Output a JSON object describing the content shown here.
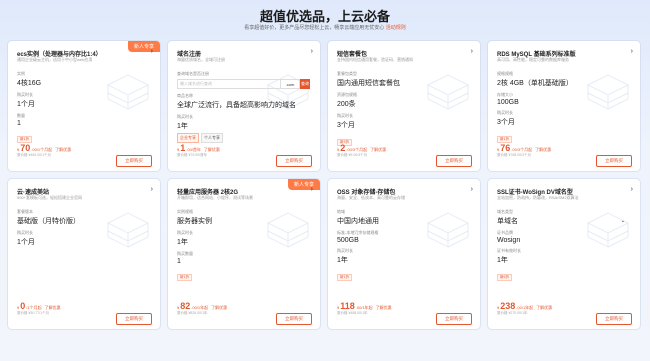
{
  "hero": {
    "title": "超值优选品，上云必备",
    "subtitle": "看享超值好价，更多产品尽您轻松上云，畅享云端应用无忧安心",
    "link": "活动规则"
  },
  "cards": [
    {
      "badge": "新人专享",
      "title": "ecs实例（处理器与内存比1:4）",
      "desc": "通用企业级云主机，适用于中小型web应用",
      "fields": [
        {
          "label": "实例",
          "value": "4核16G"
        },
        {
          "label": "购买时长",
          "value": "1个月"
        },
        {
          "label": "数量",
          "value": "1"
        }
      ],
      "promo": "新1折",
      "price": {
        "num": "70",
        "unit": ".00/1个月起",
        "extra": "了解优惠"
      },
      "orig": "原价格 ¥464.00/1个月",
      "buy": "立即购买"
    },
    {
      "title": "域名注册",
      "desc": "海量优质域名，全域可注册",
      "input": {
        "label": "查询域名是否注册",
        "placeholder": "输入域名进行查询",
        "suffix": ".com",
        "btn": "查询"
      },
      "fields": [
        {
          "label": "商品名称",
          "value": "全球广泛流行，具备超高影响力的域名"
        },
        {
          "label": "购买时长",
          "value": "1年"
        }
      ],
      "chips": [
        "企业专享",
        "个人专享"
      ],
      "price": {
        "num": "1",
        "unit": ".00/首年",
        "extra": "了解优惠"
      },
      "orig": "原价格 ¥79.00/首年",
      "buy": "立即购买"
    },
    {
      "title": "短信套餐包",
      "desc": "支持国内短信通用套餐，验证码、营销通知",
      "fields": [
        {
          "label": "套餐包类型",
          "value": "国内通用短信套餐包"
        },
        {
          "label": "资源包规格",
          "value": "200条"
        },
        {
          "label": "购买时长",
          "value": "3个月"
        }
      ],
      "promo": "新3折",
      "price": {
        "num": "2",
        "unit": ".00/3个月起",
        "extra": "了解优惠"
      },
      "orig": "原价格 ¥9.00/3个月",
      "buy": "立即购买"
    },
    {
      "title": "RDS MySQL 基础系列标准版",
      "desc": "高可用、高性能，稳定可靠的数据库服务",
      "fields": [
        {
          "label": "规格规格",
          "value": "2核 4GB（单机基础版）"
        },
        {
          "label": "存储大小",
          "value": "100GB"
        },
        {
          "label": "购买时长",
          "value": "3个月"
        }
      ],
      "promo": "新1折",
      "price": {
        "num": "76",
        "unit": ".00/3个月起",
        "extra": "了解优惠"
      },
      "orig": "原价格 ¥768.00/3个月",
      "buy": "立即购买"
    },
    {
      "title": "云·速成美站",
      "desc": "500+套模板可选，轻松搭建企业官网",
      "fields": [
        {
          "label": "套餐版本",
          "value": "基础版（月特价版）"
        },
        {
          "label": "购买时长",
          "value": "1个月"
        }
      ],
      "price": {
        "num": "0",
        "unit": "/1个月起",
        "extra": "了解优惠"
      },
      "orig": "原价格 ¥30.77/1个月",
      "buy": "立即购买"
    },
    {
      "badge": "新人专享",
      "title": "轻量应用服务器 2核2G",
      "desc": "开箱即用，适合网站、小程序、测试等场景",
      "fields": [
        {
          "label": "实例规格",
          "value": "服务器实例"
        },
        {
          "label": "购买时长",
          "value": "1年"
        },
        {
          "label": "购买数量",
          "value": "1"
        }
      ],
      "promo": "新1折",
      "price": {
        "num": "82",
        "unit": ".00/1年起",
        "extra": "了解优惠"
      },
      "orig": "原价格 ¥826.00/1年",
      "buy": "立即购买"
    },
    {
      "title": "OSS 对象存储-存储包",
      "desc": "海量、安全、低成本、高可靠的云存储",
      "fields": [
        {
          "label": "地域",
          "value": "中国内地通用"
        },
        {
          "label": "标准-本地冗余存储规格",
          "value": "500GB"
        },
        {
          "label": "购买时长",
          "value": "1年"
        }
      ],
      "promo": "新1折",
      "price": {
        "num": "118",
        "unit": ".00/1年起",
        "extra": "了解优惠"
      },
      "orig": "原价格 ¥488.00/1年",
      "buy": "立即购买"
    },
    {
      "title": "SSL证书-WoSign DV域名型",
      "desc": "全站加密，防劫持，防篡改，RSA/SM2双算法",
      "fields": [
        {
          "label": "域名类型",
          "value": "单域名"
        },
        {
          "label": "证书品牌",
          "value": "Wosign"
        },
        {
          "label": "证书有效时长",
          "value": "1年"
        }
      ],
      "promo": "新6折",
      "price": {
        "num": "238",
        "unit": ".00/1年起",
        "extra": "了解优惠"
      },
      "orig": "原价格 ¥270.00/1年",
      "buy": "立即购买"
    }
  ]
}
